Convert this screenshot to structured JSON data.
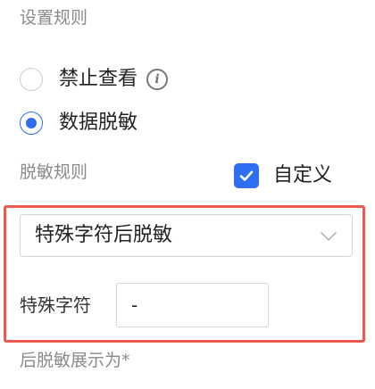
{
  "settings": {
    "title": "设置规则",
    "options": [
      {
        "label": "禁止查看",
        "checked": false,
        "info_icon": "info-circle-icon"
      },
      {
        "label": "数据脱敏",
        "checked": true
      }
    ]
  },
  "rules": {
    "title": "脱敏规则",
    "custom_checkbox": {
      "label": "自定义",
      "checked": true,
      "icon": "checkmark-icon"
    },
    "select": {
      "value": "特殊字符后脱敏",
      "icon": "chevron-down-icon"
    },
    "special_char": {
      "label": "特殊字符",
      "value": "-"
    }
  },
  "display": {
    "title": "后脱敏展示为*"
  },
  "colors": {
    "accent": "#2d6ff0",
    "highlight_border": "#ec5a4f",
    "section_title": "#8a8a8a"
  }
}
